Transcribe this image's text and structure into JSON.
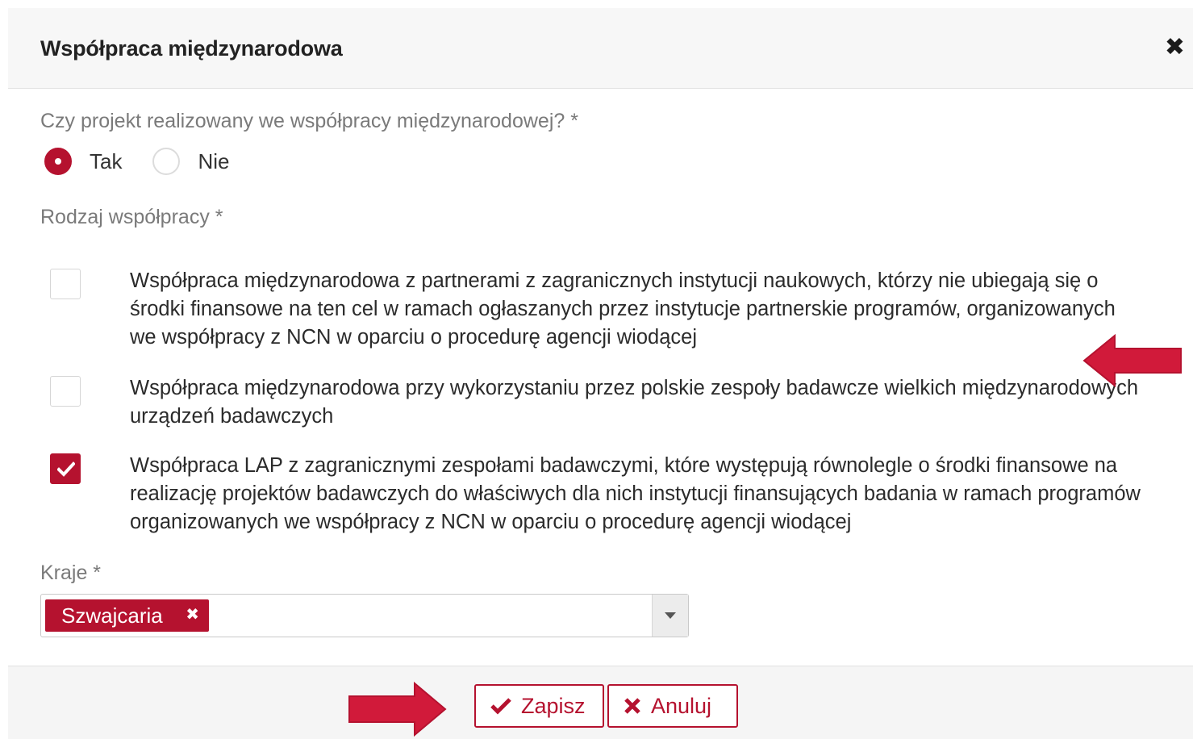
{
  "modal": {
    "title": "Współpraca międzynarodowa",
    "close_symbol": "✖"
  },
  "question1": {
    "label": "Czy projekt realizowany we współpracy międzynarodowej? *",
    "options": [
      {
        "label": "Tak",
        "selected": true
      },
      {
        "label": "Nie",
        "selected": false
      }
    ]
  },
  "question2": {
    "label": "Rodzaj współpracy *",
    "options": [
      {
        "text": "Współpraca międzynarodowa z partnerami z zagranicznych instytucji naukowych, którzy nie ubiegają się o środki finansowe na ten cel w ramach ogłaszanych przez instytucje partnerskie programów, organizowanych we współpracy z NCN w oparciu o procedurę agencji wiodącej",
        "checked": false
      },
      {
        "text": "Współpraca międzynarodowa przy wykorzystaniu przez polskie zespoły badawcze wielkich międzynarodowych urządzeń badawczych",
        "checked": false
      },
      {
        "text": "Współpraca LAP z zagranicznymi zespołami badawczymi, które występują równolegle o środki finansowe na realizację projektów badawczych do właściwych dla nich instytucji finansujących badania w ramach programów organizowanych we współpracy z NCN w oparciu o procedurę agencji wiodącej",
        "checked": true
      }
    ]
  },
  "countries": {
    "label": "Kraje *",
    "selected_tags": [
      "Szwajcaria"
    ],
    "tag_remove_symbol": "✖"
  },
  "footer": {
    "save_label": "Zapisz",
    "cancel_label": "Anuluj"
  },
  "colors": {
    "accent": "#b5122f",
    "annotation_arrow": "#d11a3a"
  },
  "icons": {
    "save": "check-icon",
    "cancel": "x-icon",
    "close": "close-icon",
    "dropdown": "caret-down-icon",
    "annotation": "red-arrow-icon"
  }
}
